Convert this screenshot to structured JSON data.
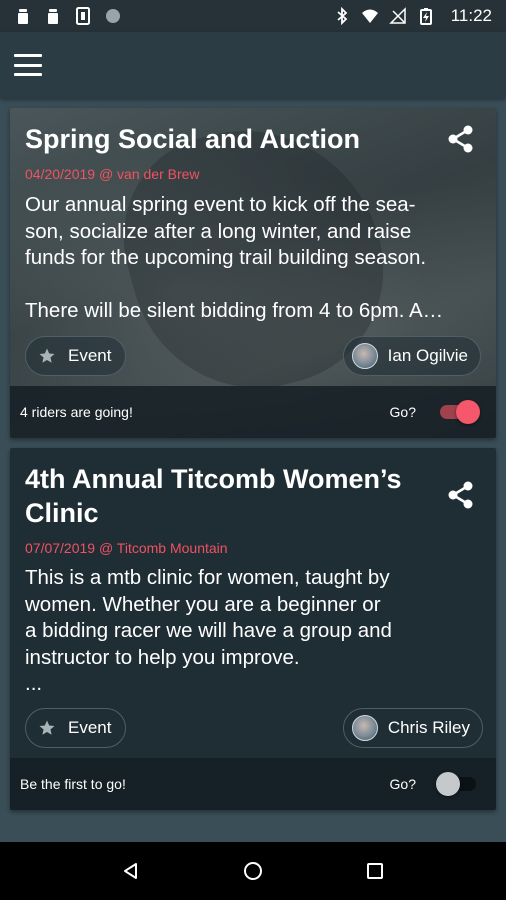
{
  "status_bar": {
    "time": "11:22",
    "left_icons": [
      "notification-icon",
      "notification-icon",
      "sim-icon",
      "circle-icon"
    ],
    "right_icons": [
      "bluetooth-icon",
      "wifi-icon",
      "signal-off-icon",
      "battery-charging-icon"
    ]
  },
  "events": [
    {
      "title": "Spring Social and Auction",
      "subtitle": "04/20/2019 @ van der Brew",
      "description": "Our annual spring event to kick off the sea-\nson, socialize after a long winter, and raise\nfunds for the upcoming trail building season.\n\nThere will be silent bidding from 4 to 6pm. A…",
      "type_label": "Event",
      "organizer": "Ian Ogilvie",
      "going_text": "4 riders are going!",
      "go_label": "Go?",
      "going": true
    },
    {
      "title": "4th Annual Titcomb Women’s Clinic",
      "subtitle": "07/07/2019 @ Titcomb Mountain",
      "description": "This is a mtb clinic for women, taught by\nwomen.   Whether you are a beginner or\na bidding racer we will have a group and\ninstructor to help you improve.\n...",
      "type_label": "Event",
      "organizer": "Chris Riley",
      "going_text": "Be the first to go!",
      "go_label": "Go?",
      "going": false
    }
  ],
  "colors": {
    "accent": "#f4586a",
    "subtitle": "#ef5361",
    "background": "#3a4e58",
    "card": "#1f2d35"
  }
}
